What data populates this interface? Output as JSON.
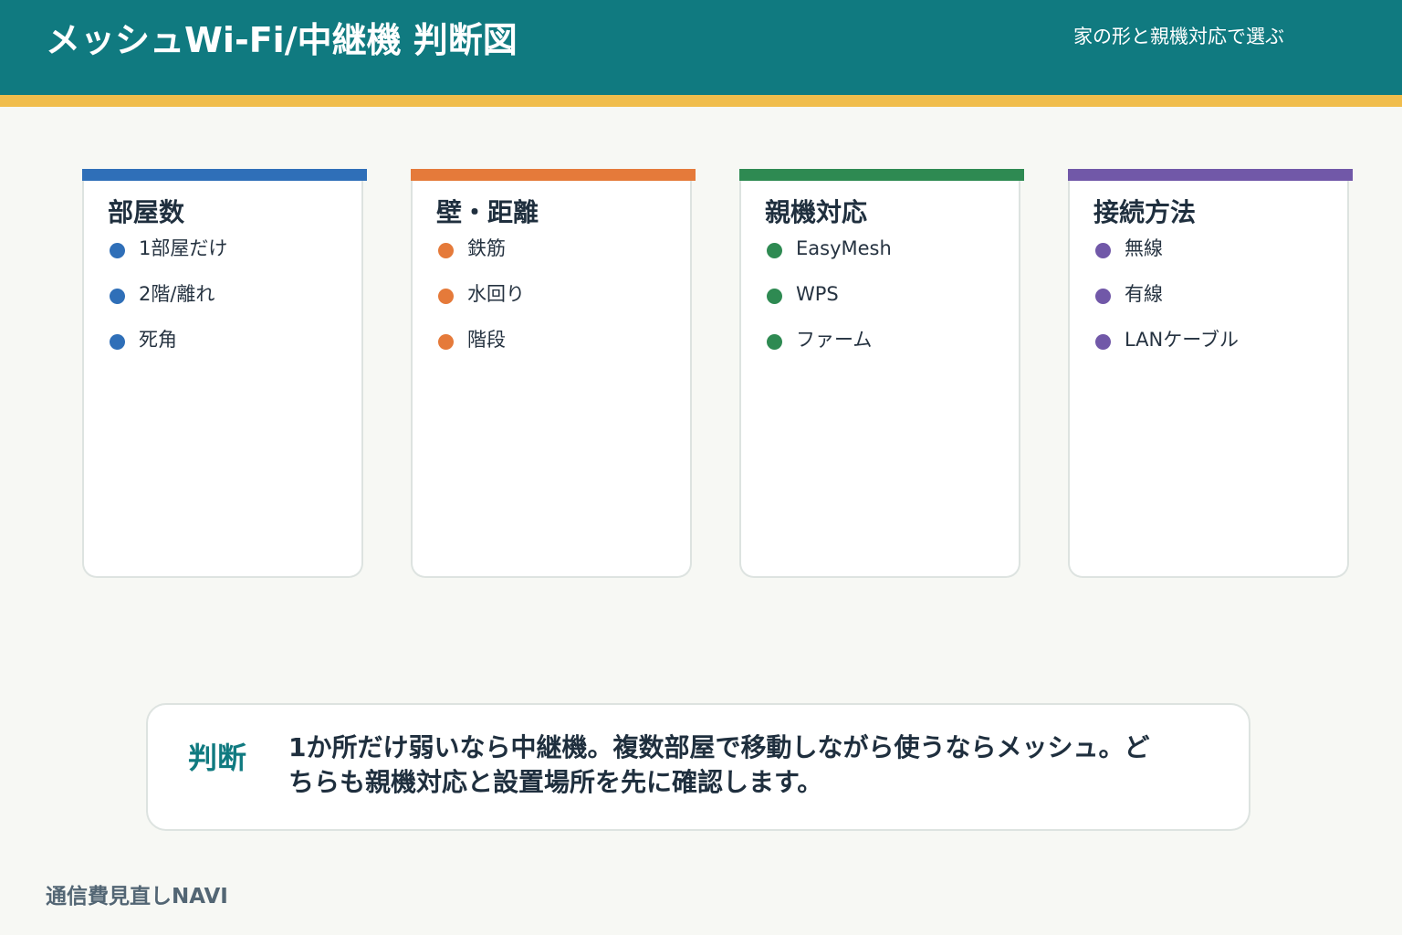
{
  "header": {
    "title": "メッシュWi-Fi/中継機 判断図",
    "subtitle": "家の形と親機対応で選ぶ"
  },
  "colors": {
    "header_bg": "#107a80",
    "header_stripe": "#f0bd4c",
    "card1_accent": "#2f6fb8",
    "card2_accent": "#e57a3a",
    "card3_accent": "#2e8a52",
    "card4_accent": "#7158a8"
  },
  "cards": [
    {
      "title": "部屋数",
      "items": [
        "1部屋だけ",
        "2階/離れ",
        "死角"
      ]
    },
    {
      "title": "壁・距離",
      "items": [
        "鉄筋",
        "水回り",
        "階段"
      ]
    },
    {
      "title": "親機対応",
      "items": [
        "EasyMesh",
        "WPS",
        "ファーム"
      ]
    },
    {
      "title": "接続方法",
      "items": [
        "無線",
        "有線",
        "LANケーブル"
      ]
    }
  ],
  "verdict": {
    "label": "判断",
    "text": "1か所だけ弱いなら中継機。複数部屋で移動しながら使うならメッシュ。どちらも親機対応と設置場所を先に確認します。"
  },
  "footer": {
    "brand": "通信費見直しNAVI"
  }
}
